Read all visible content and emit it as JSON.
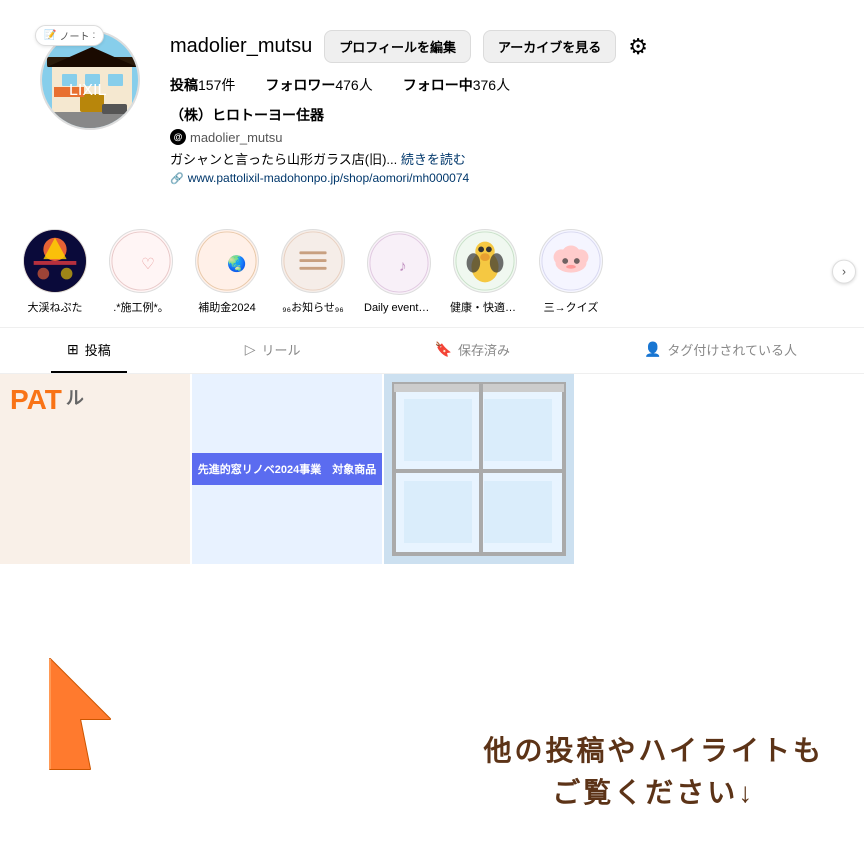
{
  "profile": {
    "note_badge": "ノート",
    "username": "madolier_mutsu",
    "btn_edit": "プロフィールを編集",
    "btn_archive": "アーカイブを見る",
    "stats": {
      "posts_label": "投稿",
      "posts_count": "157件",
      "followers_label": "フォロワー",
      "followers_count": "476人",
      "following_label": "フォロー中",
      "following_count": "376人"
    },
    "display_name": "（株）ヒロトーヨー住器",
    "threads_handle": "madolier_mutsu",
    "bio": "ガシャンと言ったら山形ガラス店(旧)...",
    "bio_more": "続きを読む",
    "website": "www.pattolixil-madohonpo.jp/shop/aomori/mh000074"
  },
  "highlights": [
    {
      "id": "nebuta",
      "label": "大渓ねぷた",
      "emoji": "🎆"
    },
    {
      "id": "heart",
      "label": ".*施工例*。",
      "emoji": "🤍"
    },
    {
      "id": "globe",
      "label": "補助金2024",
      "emoji": "🌍"
    },
    {
      "id": "menu",
      "label": "₉₆ お知らせ₉₆",
      "emoji": "☰"
    },
    {
      "id": "music",
      "label": "Daily events",
      "emoji": "🎵"
    },
    {
      "id": "bird",
      "label": "健康・快適・...",
      "emoji": "🐦"
    },
    {
      "id": "cloud",
      "label": "三→クイズ",
      "emoji": "☁️"
    }
  ],
  "tabs": [
    {
      "id": "posts",
      "label": "投稿",
      "icon": "⊞",
      "active": true
    },
    {
      "id": "reels",
      "label": "リール",
      "icon": "⏺"
    },
    {
      "id": "saved",
      "label": "保存済み",
      "icon": "🔖"
    },
    {
      "id": "tagged",
      "label": "タグ付けされている人",
      "icon": "👤"
    }
  ],
  "posts": [
    {
      "id": "post1",
      "type": "pat"
    },
    {
      "id": "post2",
      "type": "banner",
      "banner_text": "先進的窓リノベ2024事業　対象商品"
    },
    {
      "id": "post3",
      "type": "window"
    }
  ],
  "cta": {
    "line1": "他の投稿やハイライトも",
    "line2": "ご覧ください↓"
  }
}
